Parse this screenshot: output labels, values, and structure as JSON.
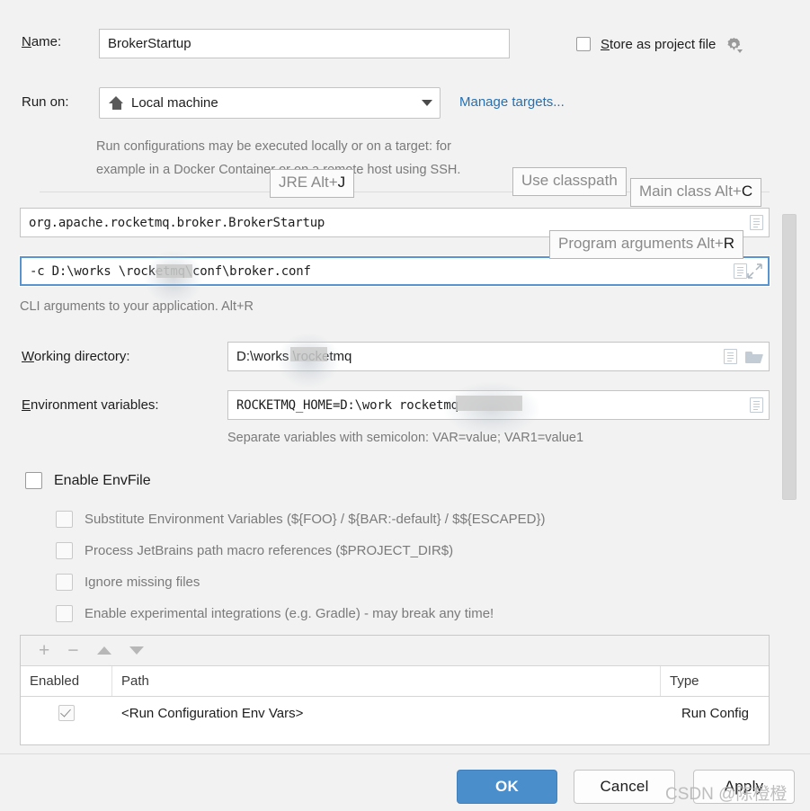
{
  "dialog": {
    "name_label": "Name:",
    "name_label_mnemonic": "N",
    "name_value": "BrokerStartup",
    "store_as_project_file_label": "Store as project file",
    "store_as_project_file_mnemonic": "S",
    "store_as_project_file_checked": false,
    "gear_icon": "gear-icon",
    "run_on_label": "Run on:",
    "run_on_value": "Local machine",
    "run_on_icon": "home-icon",
    "manage_targets_link": "Manage targets...",
    "description_line1": "Run configurations may be executed locally or on a target: for",
    "description_line2": "example in a Docker Container or on a remote host using SSH.",
    "main_class_value": "org.apache.rocketmq.broker.BrokerStartup",
    "program_arguments_value": "-c  D:\\works          \\rocketmq\\conf\\broker.conf",
    "program_arguments_hint": "CLI arguments to your application. Alt+R",
    "working_directory_label": "Working directory:",
    "working_directory_mnemonic": "W",
    "working_directory_value": "D:\\works        \\rocketmq",
    "environment_variables_label": "Environment variables:",
    "environment_variables_mnemonic": "E",
    "environment_variables_value": "ROCKETMQ_HOME=D:\\work             rocketmq",
    "environment_variables_hint": "Separate variables with semicolon: VAR=value; VAR1=value1"
  },
  "tooltips": [
    {
      "name": "jre-tooltip",
      "text": "JRE Alt+",
      "accel": "J"
    },
    {
      "name": "use-classpath-tooltip",
      "text": "Use classpath",
      "accel": ""
    },
    {
      "name": "main-class-tooltip",
      "text": "Main class Alt+",
      "accel": "C"
    },
    {
      "name": "program-arguments-tooltip",
      "text": "Program arguments Alt+",
      "accel": "R"
    }
  ],
  "envfile": {
    "enable_label": "Enable EnvFile",
    "enable_checked": false,
    "options": [
      {
        "label": "Substitute Environment Variables (${FOO} / ${BAR:-default} / $${ESCAPED})",
        "checked": false
      },
      {
        "label": "Process JetBrains path macro references ($PROJECT_DIR$)",
        "checked": false
      },
      {
        "label": "Ignore missing files",
        "checked": false
      },
      {
        "label": "Enable experimental integrations (e.g. Gradle) - may break any time!",
        "checked": false
      }
    ]
  },
  "envfile_table": {
    "toolbar": [
      {
        "name": "add-button",
        "glyph": "+"
      },
      {
        "name": "remove-button",
        "glyph": "−"
      },
      {
        "name": "move-up-button",
        "glyph": "▲"
      },
      {
        "name": "move-down-button",
        "glyph": "▼"
      }
    ],
    "columns": [
      "Enabled",
      "Path",
      "Type"
    ],
    "rows": [
      {
        "enabled": true,
        "path": "<Run Configuration Env Vars>",
        "type": "Run Config"
      }
    ]
  },
  "footer": {
    "ok_label": "OK",
    "cancel_label": "Cancel",
    "apply_label": "Apply"
  },
  "watermark": {
    "text": "CSDN @陈橙橙"
  },
  "colors": {
    "accent": "#4a8ecb",
    "link": "#2470b3",
    "background": "#f2f2f2",
    "field_border": "#c4c4c4",
    "focus_border": "#5894cf"
  }
}
